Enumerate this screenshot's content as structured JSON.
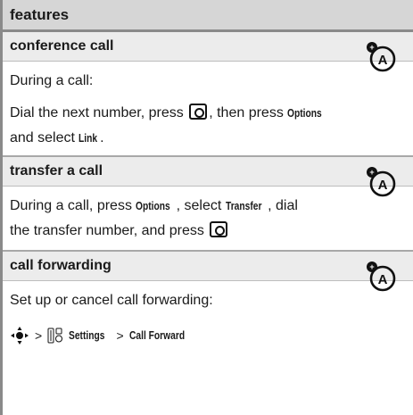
{
  "header": {
    "title": "features"
  },
  "sections": [
    {
      "title": "conference call",
      "icon": "network-feature-icon",
      "p1": "During a call:",
      "p2_a": "Dial the next number, press",
      "p2_b": ", then press",
      "p2_options": "Options",
      "p2_c": "and select",
      "p2_link": "Link",
      "p2_d": "."
    },
    {
      "title": "transfer a call",
      "icon": "network-feature-icon",
      "p1_a": "During a call, press",
      "p1_options": "Options",
      "p1_b": ", select",
      "p1_transfer": "Transfer",
      "p1_c": ", dial",
      "p1_d": "the transfer number, and press"
    },
    {
      "title": "call forwarding",
      "icon": "network-feature-icon",
      "p1": "Set up or cancel call forwarding:",
      "path_sep1": ">",
      "path_settings": "Settings",
      "path_sep2": ">",
      "path_forward": "Call Forward"
    }
  ]
}
